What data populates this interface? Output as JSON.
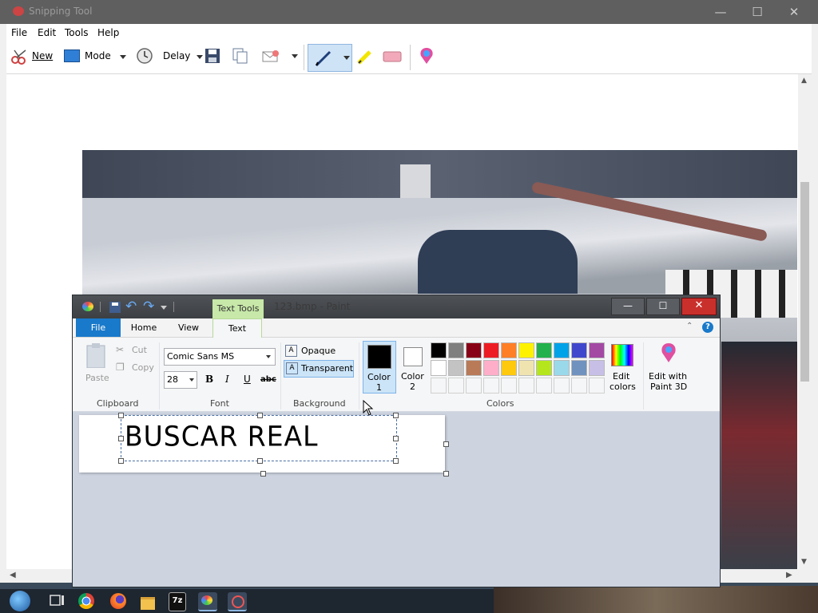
{
  "snipping": {
    "title": "Snipping Tool",
    "menu": [
      "File",
      "Edit",
      "Tools",
      "Help"
    ],
    "toolbar": {
      "new_label": "New",
      "mode_label": "Mode",
      "delay_label": "Delay"
    }
  },
  "paint": {
    "context_tab": "Text Tools",
    "title": "123.bmp - Paint",
    "tabs": {
      "file": "File",
      "home": "Home",
      "view": "View",
      "text": "Text"
    },
    "clipboard": {
      "paste": "Paste",
      "cut": "Cut",
      "copy": "Copy",
      "group": "Clipboard"
    },
    "font": {
      "family": "Comic Sans MS",
      "size": "28",
      "bold": "B",
      "italic": "I",
      "underline": "U",
      "strike": "abc",
      "group": "Font"
    },
    "background": {
      "opaque": "Opaque",
      "transparent": "Transparent",
      "group": "Background"
    },
    "colors": {
      "color1_label_a": "Color",
      "color1_label_b": "1",
      "color2_label_a": "Color",
      "color2_label_b": "2",
      "edit_label_a": "Edit",
      "edit_label_b": "colors",
      "group": "Colors",
      "row1": [
        "#000000",
        "#7f7f7f",
        "#880015",
        "#ed1c24",
        "#ff7f27",
        "#fff200",
        "#22b14c",
        "#00a2e8",
        "#3f48cc",
        "#a349a4"
      ],
      "row2": [
        "#ffffff",
        "#c3c3c3",
        "#b97a57",
        "#ffaec9",
        "#ffc90e",
        "#efe4b0",
        "#b5e61d",
        "#99d9ea",
        "#7092be",
        "#c8bfe7"
      ]
    },
    "paint3d": {
      "label_a": "Edit with",
      "label_b": "Paint 3D"
    },
    "canvas_text": "BUSCAR REAL"
  }
}
